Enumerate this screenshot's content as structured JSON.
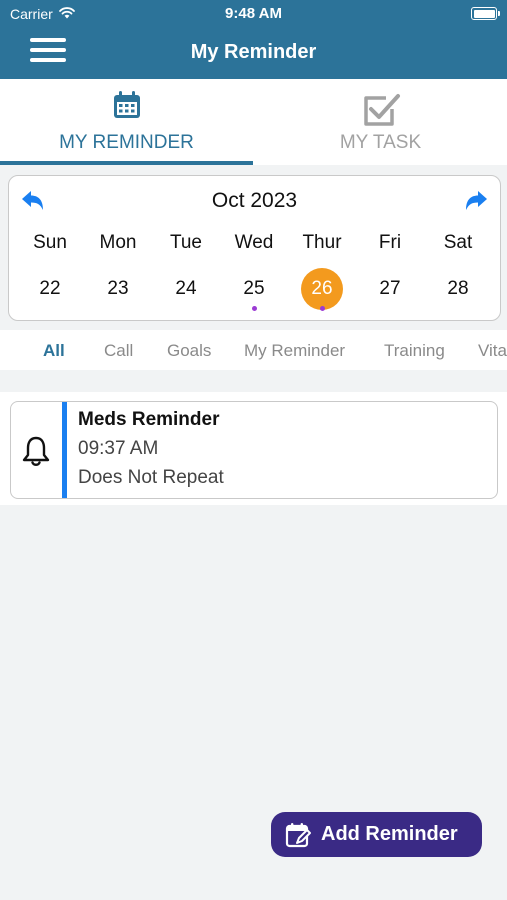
{
  "status_bar": {
    "carrier": "Carrier",
    "time": "9:48 AM"
  },
  "header": {
    "title": "My Reminder"
  },
  "tabs": [
    {
      "label": "MY REMINDER",
      "icon": "calendar-icon",
      "active": true
    },
    {
      "label": "MY TASK",
      "icon": "checkbox-icon",
      "active": false
    }
  ],
  "calendar": {
    "month_label": "Oct 2023",
    "days": [
      "Sun",
      "Mon",
      "Tue",
      "Wed",
      "Thur",
      "Fri",
      "Sat"
    ],
    "dates": [
      "22",
      "23",
      "24",
      "25",
      "26",
      "27",
      "28"
    ],
    "selected_date": "26",
    "dates_with_events": [
      "25",
      "26"
    ]
  },
  "filters": [
    "All",
    "Call",
    "Goals",
    "My Reminder",
    "Training",
    "Vita"
  ],
  "active_filter": "All",
  "reminders": [
    {
      "title": "Meds Reminder",
      "time": "09:37 AM",
      "repeat": "Does Not Repeat"
    }
  ],
  "fab": {
    "label": "Add Reminder"
  },
  "colors": {
    "primary": "#2c7399",
    "accent": "#f39a1e",
    "event_dot": "#9b3bd4",
    "card_bar": "#1a7ff0",
    "fab": "#3a2a85"
  }
}
